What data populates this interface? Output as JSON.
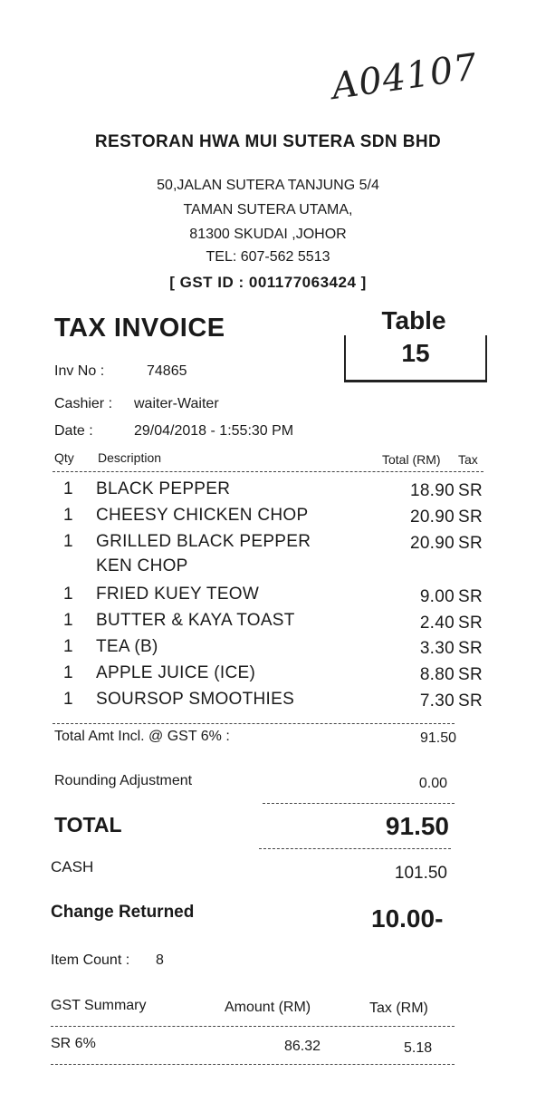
{
  "handwritten_note": "A04107",
  "header": {
    "company": "RESTORAN HWA MUI SUTERA SDN BHD",
    "address_lines": [
      "50,JALAN SUTERA TANJUNG 5/4",
      "TAMAN SUTERA UTAMA,",
      "81300 SKUDAI ,JOHOR",
      "TEL: 607-562 5513"
    ],
    "gst_id": "[ GST ID : 001177063424 ]"
  },
  "invoice": {
    "title": "TAX INVOICE",
    "table_label": "Table",
    "table_number": "15",
    "inv_no_label": "Inv No :",
    "inv_no": "74865",
    "cashier_label": "Cashier :",
    "cashier": "waiter-Waiter",
    "date_label": "Date :",
    "date": "29/04/2018 - 1:55:30 PM"
  },
  "columns": {
    "qty": "Qty",
    "description": "Description",
    "total": "Total (RM)",
    "tax": "Tax"
  },
  "items": [
    {
      "qty": "1",
      "desc": "BLACK PEPPER",
      "desc2": "",
      "total": "18.90",
      "tax": "SR"
    },
    {
      "qty": "1",
      "desc": "CHEESY CHICKEN CHOP",
      "desc2": "",
      "total": "20.90",
      "tax": "SR"
    },
    {
      "qty": "1",
      "desc": "GRILLED BLACK PEPPER",
      "desc2": "KEN CHOP",
      "total": "20.90",
      "tax": "SR"
    },
    {
      "qty": "1",
      "desc": "FRIED KUEY TEOW",
      "desc2": "",
      "total": "9.00",
      "tax": "SR"
    },
    {
      "qty": "1",
      "desc": "BUTTER & KAYA TOAST",
      "desc2": "",
      "total": "2.40",
      "tax": "SR"
    },
    {
      "qty": "1",
      "desc": "TEA  (B)",
      "desc2": "",
      "total": "3.30",
      "tax": "SR"
    },
    {
      "qty": "1",
      "desc": "APPLE JUICE (ICE)",
      "desc2": "",
      "total": "8.80",
      "tax": "SR"
    },
    {
      "qty": "1",
      "desc": "SOURSOP SMOOTHIES",
      "desc2": "",
      "total": "7.30",
      "tax": "SR"
    }
  ],
  "totals": {
    "total_amt_label": "Total Amt Incl. @ GST 6% :",
    "total_amt": "91.50",
    "rounding_label": "Rounding Adjustment",
    "rounding": "0.00",
    "total_label": "TOTAL",
    "total": "91.50",
    "cash_label": "CASH",
    "cash": "101.50",
    "change_label": "Change Returned",
    "change": "10.00-",
    "item_count_label": "Item Count :",
    "item_count": "8"
  },
  "gst_summary": {
    "header": {
      "label": "GST Summary",
      "amount": "Amount (RM)",
      "tax": "Tax (RM)"
    },
    "rows": [
      {
        "code": "SR 6%",
        "amount": "86.32",
        "tax": "5.18"
      }
    ]
  }
}
